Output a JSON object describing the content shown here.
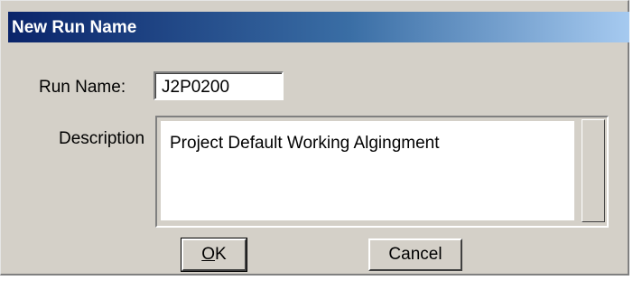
{
  "window": {
    "title": "New Run Name"
  },
  "form": {
    "run_name_label": "Run Name:",
    "run_name_value": "J2P0200",
    "description_label": "Description",
    "description_value": "Project Default Working Algingment"
  },
  "buttons": {
    "ok_access_key": "O",
    "ok_rest": "K",
    "cancel_label": "Cancel"
  }
}
